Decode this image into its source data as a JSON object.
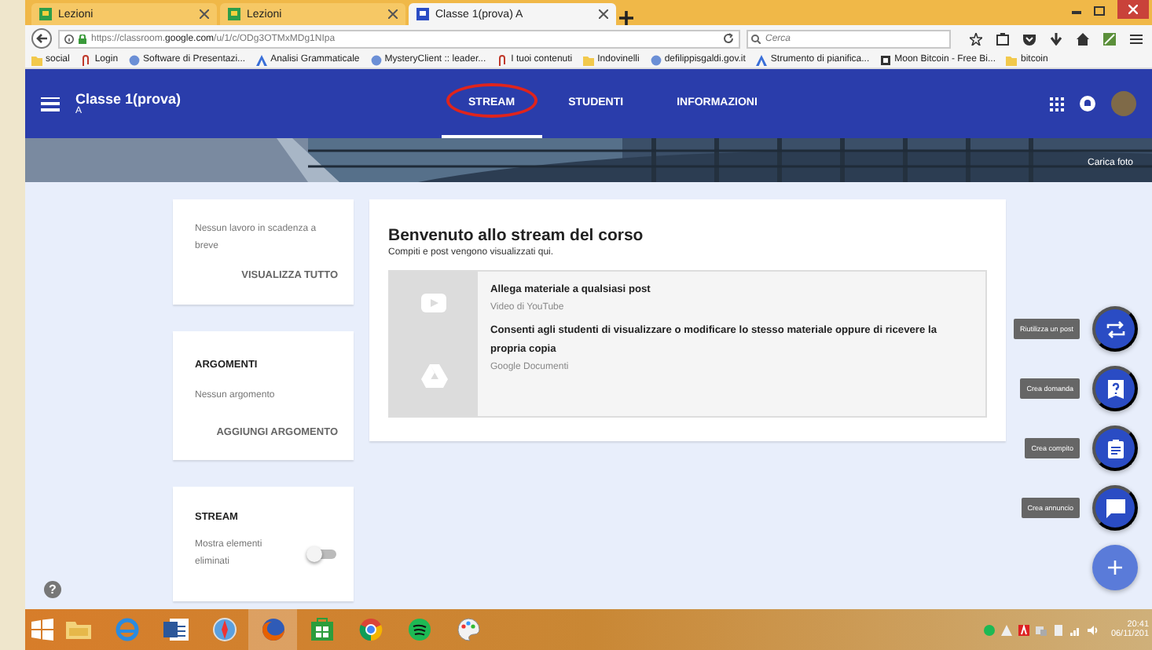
{
  "browser": {
    "tabs": [
      {
        "title": "Lezioni",
        "selected": false
      },
      {
        "title": "Lezioni",
        "selected": false
      },
      {
        "title": "Classe 1(prova) A",
        "selected": true
      }
    ],
    "url_prefix": "https://classroom.",
    "url_domain": "google.com",
    "url_path": "/u/1/c/ODg3OTMxMDg1NIpa",
    "search": {
      "placeholder": "Cerca"
    },
    "bookmarks": [
      {
        "label": "social",
        "kind": "folder"
      },
      {
        "label": "Login",
        "kind": "clip"
      },
      {
        "label": "Software di Presentazi...",
        "kind": "globe"
      },
      {
        "label": "Analisi Grammaticale",
        "kind": "letter"
      },
      {
        "label": "MysteryClient :: leader...",
        "kind": "globe"
      },
      {
        "label": "I tuoi contenuti",
        "kind": "clip"
      },
      {
        "label": "Indovinelli",
        "kind": "folder"
      },
      {
        "label": "defilippisgaldi.gov.it",
        "kind": "globe"
      },
      {
        "label": "Strumento di pianifica...",
        "kind": "letter"
      },
      {
        "label": "Moon Bitcoin - Free Bi...",
        "kind": "square"
      },
      {
        "label": "bitcoin",
        "kind": "folder"
      }
    ]
  },
  "header": {
    "title": "Classe 1(prova)",
    "subtitle": "A",
    "nav": [
      {
        "label": "STREAM",
        "selected": true,
        "circled": true
      },
      {
        "label": "STUDENTI",
        "selected": false,
        "circled": false
      },
      {
        "label": "INFORMAZIONI",
        "selected": false,
        "circled": false
      }
    ],
    "banner_action": "Carica foto"
  },
  "upcoming": {
    "text": "Nessun lavoro in scadenza a breve",
    "action": "VISUALIZZA TUTTO"
  },
  "topics": {
    "title": "ARGOMENTI",
    "text": "Nessun argomento",
    "action": "AGGIUNGI ARGOMENTO"
  },
  "stream_settings": {
    "title": "STREAM",
    "label": "Mostra elementi eliminati",
    "on": false
  },
  "welcome": {
    "title": "Benvenuto allo stream del corso",
    "subtitle": "Compiti e post vengono visualizzati qui.",
    "items": [
      {
        "kind": "video",
        "title": "Allega materiale a qualsiasi post",
        "source": "Video di YouTube"
      },
      {
        "kind": "drive",
        "title": "Consenti agli studenti di visualizzare o modificare lo stesso materiale oppure di ricevere la propria copia",
        "source": "Google Documenti"
      }
    ]
  },
  "fab_actions": [
    {
      "kind": "reuse",
      "label": "Riutilizza un post"
    },
    {
      "kind": "question",
      "label": "Crea domanda"
    },
    {
      "kind": "assignment",
      "label": "Crea compito"
    },
    {
      "kind": "announcement",
      "label": "Crea annuncio"
    }
  ],
  "help": "?",
  "taskbar": {
    "apps": [
      {
        "kind": "folder",
        "active": false
      },
      {
        "kind": "ie",
        "active": false
      },
      {
        "kind": "word",
        "active": false
      },
      {
        "kind": "compass",
        "active": false
      },
      {
        "kind": "firefox",
        "active": true
      },
      {
        "kind": "store",
        "active": false
      },
      {
        "kind": "chrome",
        "active": false
      },
      {
        "kind": "spotify",
        "active": false
      },
      {
        "kind": "paint",
        "active": false
      }
    ],
    "time": "20:41",
    "date": "06/11/201"
  }
}
